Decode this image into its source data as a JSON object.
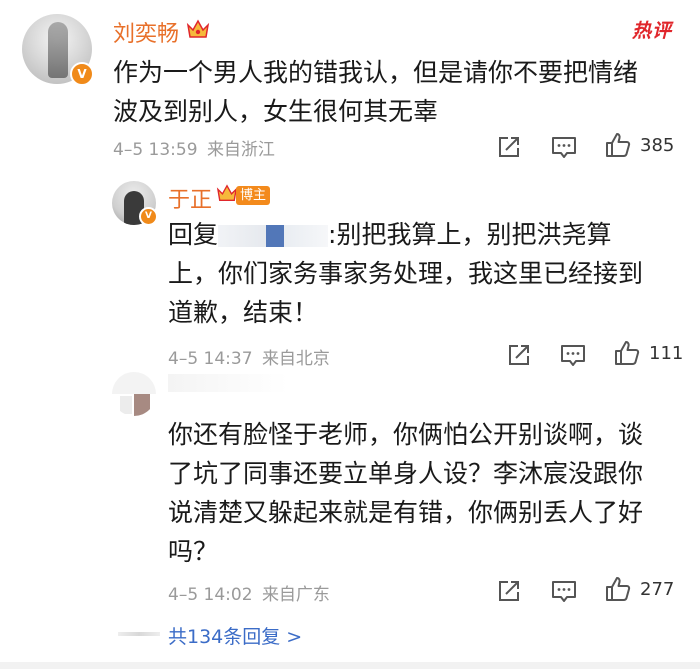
{
  "badge": {
    "hot_label": "热评"
  },
  "main_comment": {
    "username": "刘奕畅",
    "text_line1": "作为一个男人我的错我认，但是请你不要把情绪",
    "text_line2": "波及到别人，女生很何其无辜",
    "time": "4–5 13:59",
    "location": "来自浙江",
    "like_count": "385"
  },
  "reply_1": {
    "username": "于正",
    "tag": "博主",
    "reply_prefix": "回复",
    "text_line1_rest": ":别把我算上，别把洪尧算",
    "text_line2": "上，你们家务事家务处理，我这里已经接到",
    "text_line3": "道歉，结束！",
    "time": "4–5 14:37",
    "location": "来自北京",
    "like_count": "111"
  },
  "reply_2": {
    "text_line1": "你还有脸怪于老师，你俩怕公开别谈啊，谈",
    "text_line2": "了坑了同事还要立单身人设？李沐宸没跟你",
    "text_line3": "说清楚又躲起来就是有错，你俩别丢人了好",
    "text_line4": "吗？",
    "time": "4–5 14:02",
    "location": "来自广东",
    "like_count": "277"
  },
  "footer": {
    "more_replies": "共134条回复 >"
  },
  "colors": {
    "username": "#e8702a",
    "hot": "#e0262b",
    "link": "#3b6cc7",
    "meta": "#9a9a9a"
  },
  "icons": [
    "share-icon",
    "comment-icon",
    "like-icon",
    "crown-badge-icon",
    "verified-icon"
  ]
}
